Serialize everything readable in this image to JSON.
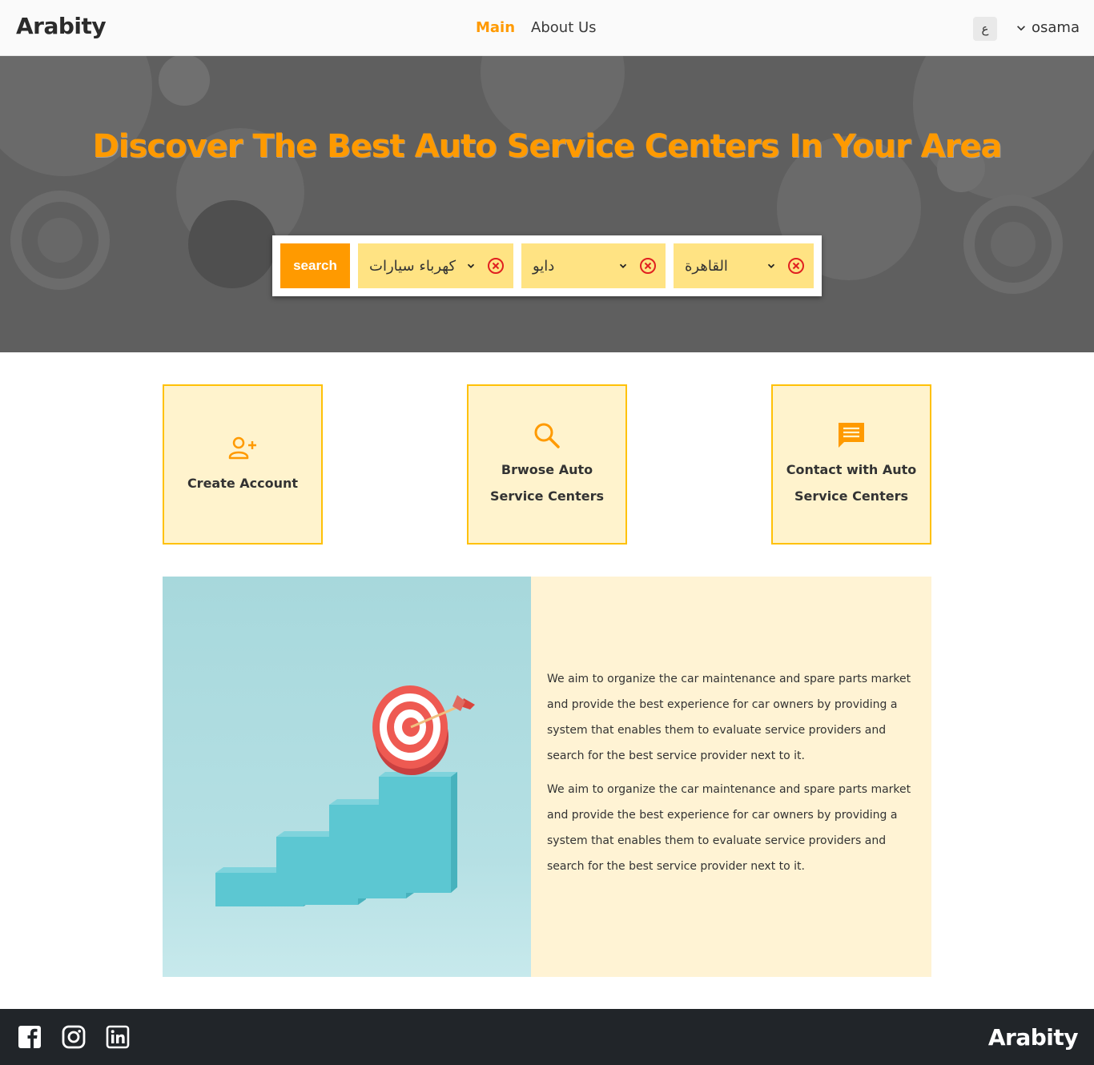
{
  "nav": {
    "brand": "Arabity",
    "links": [
      {
        "label": "Main",
        "active": true
      },
      {
        "label": "About Us",
        "active": false
      }
    ],
    "lang_button": "ع",
    "user_name": "osama"
  },
  "hero": {
    "title": "Discover The Best Auto Service Centers In Your Area",
    "search_button": "search",
    "selects": [
      {
        "value": "كهرباء سيارات"
      },
      {
        "value": "دايو"
      },
      {
        "value": "القاهرة"
      }
    ]
  },
  "features": [
    {
      "label": "Create Account",
      "icon": "user-plus-icon"
    },
    {
      "label": "Brwose Auto Service Centers",
      "icon": "search-icon"
    },
    {
      "label": "Contact with Auto Service Centers",
      "icon": "message-icon"
    }
  ],
  "about": {
    "paragraphs": [
      "We aim to organize the car maintenance and spare parts market and provide the best experience for car owners by providing a system that enables them to evaluate service providers and search for the best service provider next to it.",
      "We aim to organize the car maintenance and spare parts market and provide the best experience for car owners by providing a system that enables them to evaluate service providers and search for the best service provider next to it."
    ]
  },
  "footer": {
    "brand": "Arabity",
    "social": [
      "facebook-icon",
      "instagram-icon",
      "linkedin-icon"
    ]
  },
  "colors": {
    "accent": "#ff9a00",
    "select_bg": "#ffe383",
    "feature_bg": "#fff3cd",
    "feature_border": "#ffc107",
    "footer_bg": "#212529",
    "hero_bg": "#5f5f5f"
  }
}
